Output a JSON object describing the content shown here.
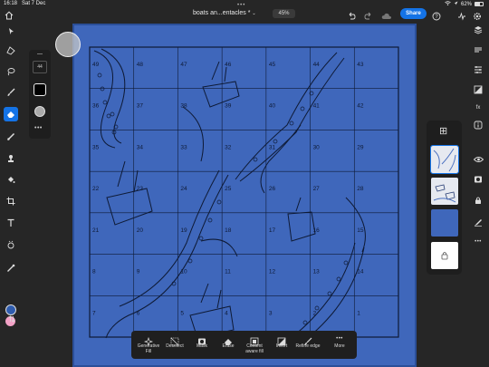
{
  "status": {
    "time": "16:18",
    "date": "Sat 7 Dec",
    "battery": "62%",
    "battery_level": 0.62
  },
  "header": {
    "doc_title": "boats an...entacles *",
    "zoom": "45%",
    "share_label": "Share"
  },
  "brush": {
    "size": "44"
  },
  "colors": {
    "canvas": "#3f67bb",
    "accent": "#1473e6",
    "foreground": "#2f5cae",
    "background": "#f2a2c6"
  },
  "tools": [
    "select-icon",
    "transform-icon",
    "lasso-icon",
    "brush-icon",
    "eraser-icon",
    "healing-icon",
    "clone-icon",
    "fill-icon",
    "crop-icon",
    "text-icon",
    "adjust-icon",
    "eyedropper-icon"
  ],
  "grid_numbers": [
    "49",
    "48",
    "47",
    "46",
    "45",
    "44",
    "43",
    "36",
    "37",
    "38",
    "39",
    "40",
    "41",
    "42",
    "35",
    "34",
    "33",
    "32",
    "31",
    "30",
    "29",
    "22",
    "23",
    "24",
    "25",
    "26",
    "27",
    "28",
    "21",
    "20",
    "19",
    "18",
    "17",
    "16",
    "15",
    "8",
    "9",
    "10",
    "11",
    "12",
    "13",
    "14",
    "7",
    "6",
    "5",
    "4",
    "3",
    "2",
    "1"
  ],
  "taskbar": {
    "items": [
      {
        "label": "Generative Fill",
        "icon": "sparkle-icon"
      },
      {
        "label": "Deselect",
        "icon": "deselect-icon"
      },
      {
        "label": "Mask",
        "icon": "mask-icon"
      },
      {
        "label": "Erase",
        "icon": "eraser-icon"
      },
      {
        "label": "Content aware fill",
        "icon": "content-fill-icon"
      },
      {
        "label": "Invert",
        "icon": "invert-icon"
      },
      {
        "label": "Refine edge",
        "icon": "refine-edge-icon"
      },
      {
        "label": "More",
        "icon": "more-icon"
      }
    ]
  }
}
